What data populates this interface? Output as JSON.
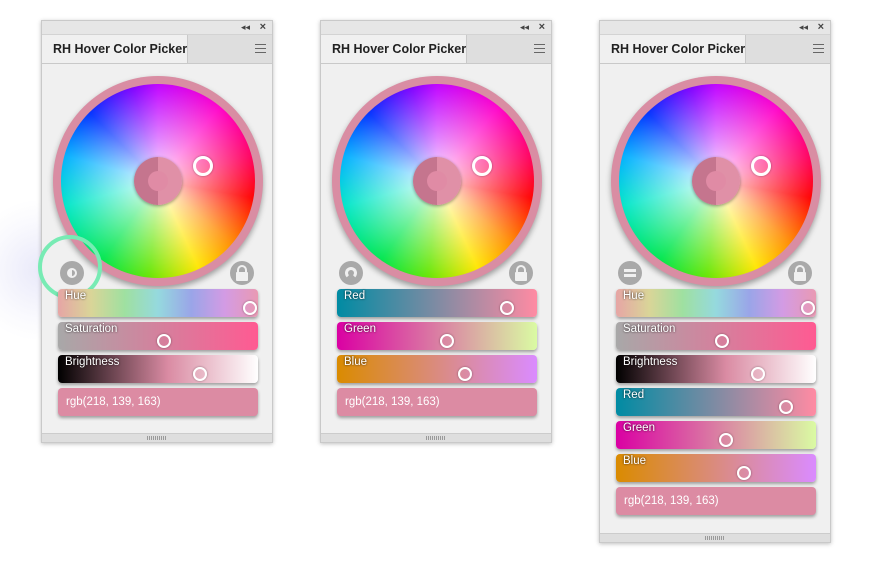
{
  "panels": [
    {
      "title": "RH Hover Color Picker",
      "mode_icon": "half-circle-icon",
      "sliders": [
        {
          "label": "Hue",
          "value": 0.96
        },
        {
          "label": "Saturation",
          "value": 0.53
        },
        {
          "label": "Brightness",
          "value": 0.71
        }
      ],
      "rgb_text": "rgb(218, 139, 163)"
    },
    {
      "title": "RH Hover Color Picker",
      "mode_icon": "arc-icon",
      "sliders": [
        {
          "label": "Red",
          "value": 0.85
        },
        {
          "label": "Green",
          "value": 0.55
        },
        {
          "label": "Blue",
          "value": 0.64
        }
      ],
      "rgb_text": "rgb(218, 139, 163)"
    },
    {
      "title": "RH Hover Color Picker",
      "mode_icon": "bars-icon",
      "sliders": [
        {
          "label": "Hue",
          "value": 0.96
        },
        {
          "label": "Saturation",
          "value": 0.53
        },
        {
          "label": "Brightness",
          "value": 0.71
        },
        {
          "label": "Red",
          "value": 0.85
        },
        {
          "label": "Green",
          "value": 0.55
        },
        {
          "label": "Blue",
          "value": 0.64
        }
      ],
      "rgb_text": "rgb(218, 139, 163)"
    }
  ],
  "colors": {
    "current": "#da8ba3",
    "previous": "#c5758e",
    "highlight_ring": "#78ebb4"
  }
}
